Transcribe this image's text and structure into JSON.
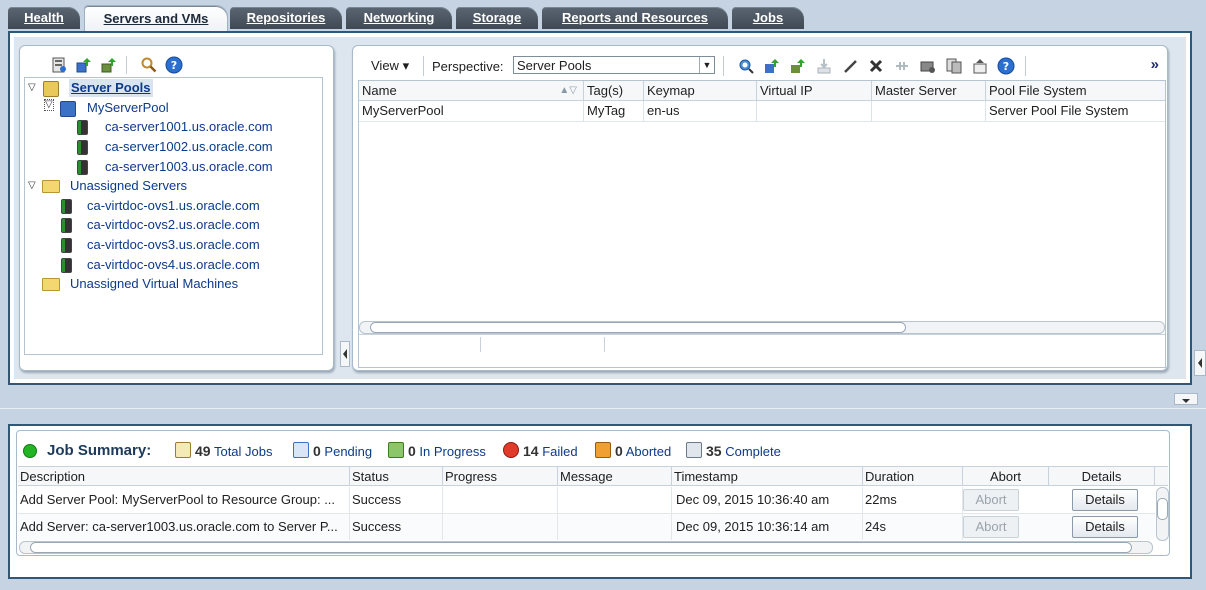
{
  "tabs": [
    {
      "label": "Health"
    },
    {
      "label": "Servers and VMs"
    },
    {
      "label": "Repositories"
    },
    {
      "label": "Networking"
    },
    {
      "label": "Storage"
    },
    {
      "label": "Reports and Resources"
    },
    {
      "label": "Jobs"
    }
  ],
  "tree": {
    "items": [
      {
        "label": "Server Pools"
      },
      {
        "label": "MyServerPool"
      },
      {
        "label": "ca-server1001.us.oracle.com"
      },
      {
        "label": "ca-server1002.us.oracle.com"
      },
      {
        "label": "ca-server1003.us.oracle.com"
      },
      {
        "label": "Unassigned Servers"
      },
      {
        "label": "ca-virtdoc-ovs1.us.oracle.com"
      },
      {
        "label": "ca-virtdoc-ovs2.us.oracle.com"
      },
      {
        "label": "ca-virtdoc-ovs3.us.oracle.com"
      },
      {
        "label": "ca-virtdoc-ovs4.us.oracle.com"
      },
      {
        "label": "Unassigned Virtual Machines"
      }
    ]
  },
  "right": {
    "view_label": "View",
    "perspective_label": "Perspective:",
    "perspective_value": "Server Pools",
    "more_label": "»",
    "columns": [
      "Name",
      "Tag(s)",
      "Keymap",
      "Virtual IP",
      "Master Server",
      "Pool File System"
    ],
    "rows": [
      [
        "MyServerPool",
        "MyTag",
        "en-us",
        "",
        "",
        "Server Pool File System"
      ]
    ]
  },
  "jobs": {
    "title": "Job Summary:",
    "total_count": "49",
    "total_label": "Total Jobs",
    "pending_count": "0",
    "pending_label": "Pending",
    "progress_count": "0",
    "progress_label": "In Progress",
    "failed_count": "14",
    "failed_label": "Failed",
    "aborted_count": "0",
    "aborted_label": "Aborted",
    "complete_count": "35",
    "complete_label": "Complete",
    "columns": [
      "Description",
      "Status",
      "Progress",
      "Message",
      "Timestamp",
      "Duration",
      "Abort",
      "Details"
    ],
    "rows": [
      {
        "description": "Add Server Pool: MyServerPool to Resource Group: ...",
        "status": "Success",
        "progress": "",
        "message": "",
        "timestamp": "Dec 09, 2015 10:36:40 am",
        "duration": "22ms",
        "abort": "Abort",
        "details": "Details"
      },
      {
        "description": "Add Server: ca-server1003.us.oracle.com to Server P...",
        "status": "Success",
        "progress": "",
        "message": "",
        "timestamp": "Dec 09, 2015 10:36:14 am",
        "duration": "24s",
        "abort": "Abort",
        "details": "Details"
      }
    ]
  },
  "colors": {
    "status_green": "#22b422",
    "link_blue": "#0c3a8a",
    "frame_blue": "#2f5877"
  },
  "icons": [
    "refresh-icon",
    "create-pool-icon",
    "upload-icon",
    "search-icon",
    "help-icon"
  ]
}
